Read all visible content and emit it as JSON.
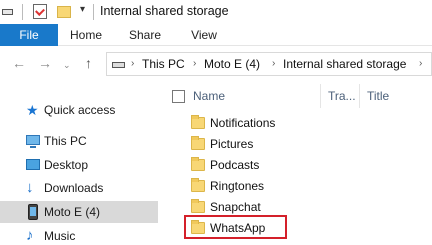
{
  "titlebar": {
    "title": "Internal shared storage",
    "dropdown_glyph": "▾"
  },
  "ribbon": {
    "tabs": [
      {
        "label": "File"
      },
      {
        "label": "Home"
      },
      {
        "label": "Share"
      },
      {
        "label": "View"
      }
    ]
  },
  "nav": {
    "back_icon": "←",
    "forward_icon": "→",
    "recent_icon": "⌄",
    "up_icon": "↑"
  },
  "address": {
    "separator": "›",
    "crumbs": [
      {
        "label": "This PC"
      },
      {
        "label": "Moto E (4)"
      },
      {
        "label": "Internal shared storage"
      }
    ]
  },
  "sidebar": {
    "items": [
      {
        "label": "Quick access",
        "icon": "star-icon"
      },
      {
        "label": "This PC",
        "icon": "computer-icon"
      },
      {
        "label": "Desktop",
        "icon": "desktop-icon"
      },
      {
        "label": "Downloads",
        "icon": "download-arrow-icon"
      },
      {
        "label": "Moto E (4)",
        "icon": "phone-icon",
        "selected": true
      },
      {
        "label": "Music",
        "icon": "music-note-icon"
      }
    ]
  },
  "columns": {
    "name": "Name",
    "type": "Tra...",
    "title": "Title"
  },
  "files": [
    {
      "name": "Notifications"
    },
    {
      "name": "Pictures"
    },
    {
      "name": "Podcasts"
    },
    {
      "name": "Ringtones"
    },
    {
      "name": "Snapchat"
    },
    {
      "name": "WhatsApp",
      "highlighted": true
    }
  ],
  "colors": {
    "accent": "#1979ca",
    "highlight_border": "#d4202a",
    "folder": "#f8d775",
    "selection": "#d9d9d9"
  }
}
